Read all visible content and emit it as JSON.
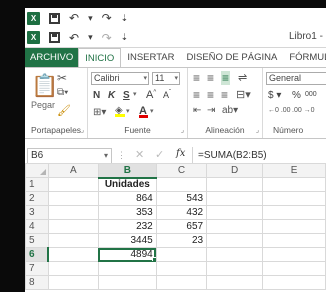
{
  "quick_access": {
    "logo_text": "X",
    "undo_icon": "undo-icon",
    "redo_icon": "redo-icon",
    "customize_icon": "customize-icon"
  },
  "window": {
    "title": "Libro1 -"
  },
  "tabs": [
    {
      "label": "ARCHIVO"
    },
    {
      "label": "INICIO"
    },
    {
      "label": "INSERTAR"
    },
    {
      "label": "DISEÑO DE PÁGINA"
    },
    {
      "label": "FÓRMULAS"
    }
  ],
  "ribbon": {
    "clipboard": {
      "label": "Portapapeles",
      "paste_label": "Pegar"
    },
    "font": {
      "label": "Fuente",
      "font_name": "Calibri",
      "font_size": "11",
      "bold": "N",
      "italic": "K",
      "underline": "S",
      "grow": "A",
      "shrink": "A"
    },
    "alignment": {
      "label": "Alineación"
    },
    "number": {
      "label": "Número",
      "format": "General",
      "currency": "$",
      "percent": "%",
      "thousands": "000",
      "inc_dec": "←0 .00",
      "dec_dec": ".00 →0"
    }
  },
  "formula_bar": {
    "name_box": "B6",
    "fx": "fx",
    "formula": "=SUMA(B2:B5)"
  },
  "sheet": {
    "columns": [
      "A",
      "B",
      "C",
      "D",
      "E"
    ],
    "rows": [
      {
        "n": "1",
        "A": "",
        "B": "Unidades",
        "C": "",
        "D": "",
        "E": ""
      },
      {
        "n": "2",
        "A": "",
        "B": "864",
        "C": "543",
        "D": "",
        "E": ""
      },
      {
        "n": "3",
        "A": "",
        "B": "353",
        "C": "432",
        "D": "",
        "E": ""
      },
      {
        "n": "4",
        "A": "",
        "B": "232",
        "C": "657",
        "D": "",
        "E": ""
      },
      {
        "n": "5",
        "A": "",
        "B": "3445",
        "C": "23",
        "D": "",
        "E": ""
      },
      {
        "n": "6",
        "A": "",
        "B": "4894",
        "C": "",
        "D": "",
        "E": ""
      },
      {
        "n": "7",
        "A": "",
        "B": "",
        "C": "",
        "D": "",
        "E": ""
      },
      {
        "n": "8",
        "A": "",
        "B": "",
        "C": "",
        "D": "",
        "E": ""
      }
    ]
  },
  "colors": {
    "excel_green": "#217346",
    "frame": "#0a0a0a"
  }
}
